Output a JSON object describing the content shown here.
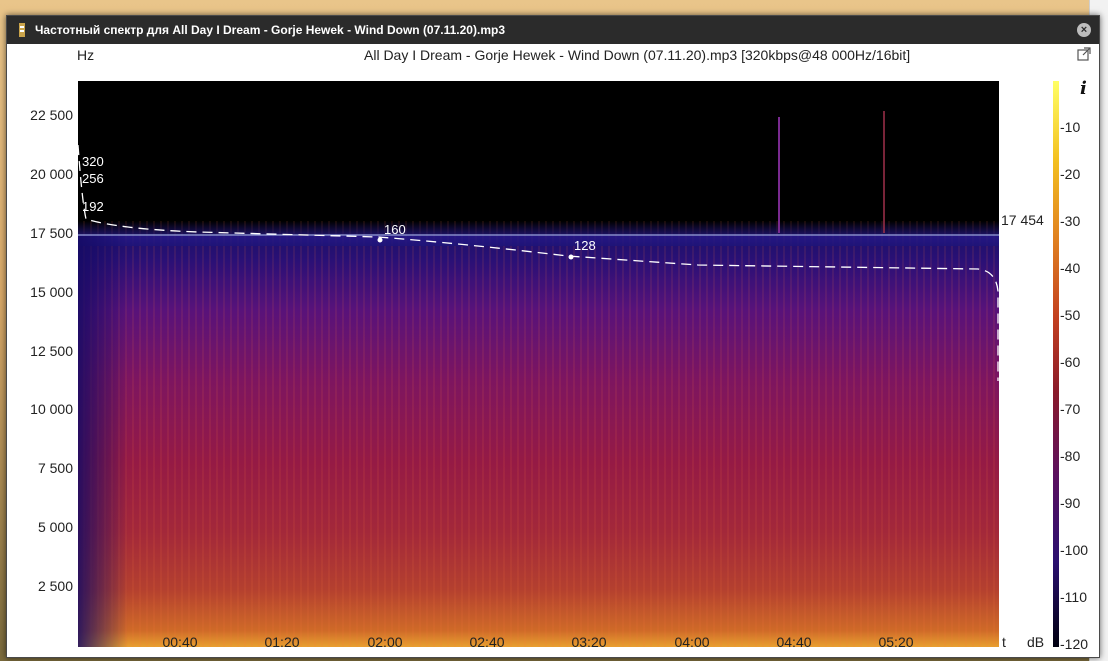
{
  "window": {
    "title": "Частотный спектр для All  Day I Dream - Gorje Hewek - Wind Down (07.11.20).mp3",
    "close_label": "×"
  },
  "spectrum": {
    "header": "All  Day I Dream - Gorje Hewek - Wind Down (07.11.20).mp3 [320kbps@48 000Hz/16bit]",
    "y_unit": "Hz",
    "y_ticks": [
      "22 500",
      "20 000",
      "17 500",
      "15 000",
      "12 500",
      "10 000",
      "7 500",
      "5 000",
      "2 500"
    ],
    "x_ticks": [
      "00:40",
      "01:20",
      "02:00",
      "02:40",
      "03:20",
      "04:00",
      "04:40",
      "05:20"
    ],
    "x_unit": "t",
    "cutoff_value": "17 454",
    "bitrate_labels": [
      "320",
      "256",
      "192",
      "160",
      "128"
    ],
    "colorbar_unit": "dB",
    "colorbar_info": "i",
    "colorbar_ticks": [
      "-10",
      "-20",
      "-30",
      "-40",
      "-50",
      "-60",
      "-70",
      "-80",
      "-90",
      "-100",
      "-110",
      "-120"
    ]
  },
  "icons": {
    "app": "spectrum-app-icon",
    "close": "close-icon",
    "popout": "popout-icon",
    "info": "info-icon"
  }
}
